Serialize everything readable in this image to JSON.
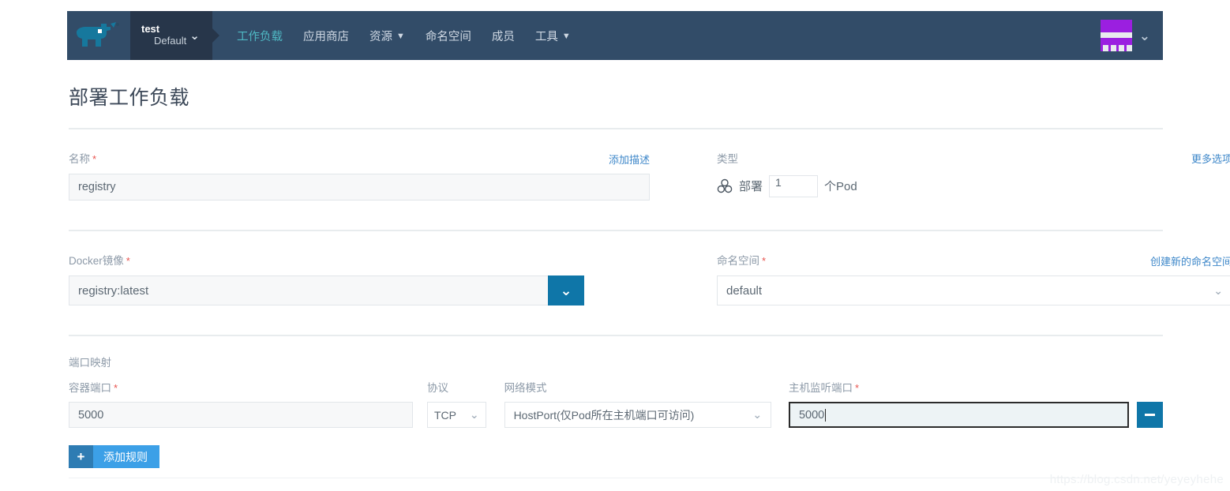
{
  "header": {
    "logo_name": "rancher-rhino-logo",
    "cluster": {
      "name": "test",
      "project": "Default",
      "chevron": "⌄"
    },
    "nav_items": [
      {
        "label": "工作负载",
        "active": true,
        "has_caret": false
      },
      {
        "label": "应用商店",
        "active": false,
        "has_caret": false
      },
      {
        "label": "资源",
        "active": false,
        "has_caret": true
      },
      {
        "label": "命名空间",
        "active": false,
        "has_caret": false
      },
      {
        "label": "成员",
        "active": false,
        "has_caret": false
      },
      {
        "label": "工具",
        "active": false,
        "has_caret": true
      }
    ],
    "avatar_chevron": "⌄"
  },
  "page": {
    "title": "部署工作负载"
  },
  "name_field": {
    "label": "名称",
    "required_mark": "*",
    "action_link": "添加描述",
    "value": "registry"
  },
  "type_field": {
    "label": "类型",
    "action_link": "更多选项",
    "icon": "scale-deployment-icon",
    "deploy_word": "部署",
    "count": "1",
    "pod_word": "个Pod"
  },
  "image_field": {
    "label": "Docker镜像",
    "required_mark": "*",
    "value": "registry:latest",
    "dropdown_chevron": "⌄"
  },
  "namespace_field": {
    "label": "命名空间",
    "required_mark": "*",
    "action_link": "创建新的命名空间",
    "value": "default",
    "chevron": "⌄"
  },
  "port_mapping": {
    "section_label": "端口映射",
    "container_port": {
      "label": "容器端口",
      "required_mark": "*",
      "value": "5000"
    },
    "protocol": {
      "label": "协议",
      "value": "TCP",
      "chevron": "⌄"
    },
    "network_mode": {
      "label": "网络模式",
      "value": "HostPort(仅Pod所在主机端口可访问)",
      "chevron": "⌄"
    },
    "host_port": {
      "label": "主机监听端口",
      "required_mark": "*",
      "value": "5000",
      "focused": true
    },
    "remove_button_icon": "minus-icon",
    "add_rule": {
      "plus_icon": "+",
      "label": "添加规则"
    }
  },
  "watermark": {
    "text": "https://blog.csdn.net/yeyeyhehe"
  },
  "colors": {
    "header_bg": "#324c68",
    "cluster_bg": "#27364a",
    "active_nav": "#4fb9c4",
    "accent_blue": "#0f76a8",
    "add_button_light": "#3ca0e7",
    "add_button_dark": "#2e7cb3",
    "link_blue": "#3d87c9",
    "required_red": "#e8544f",
    "avatar_purple": "#9b1fe0"
  }
}
